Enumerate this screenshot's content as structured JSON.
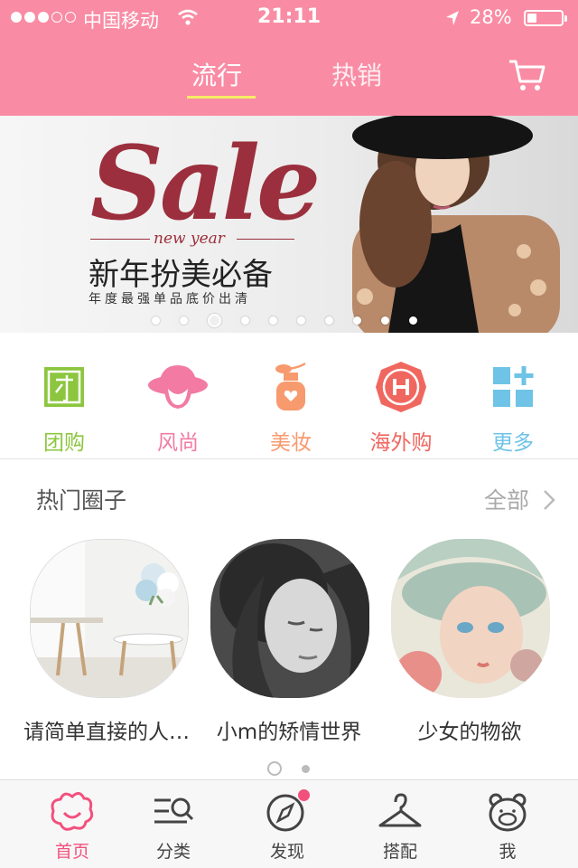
{
  "status_bar": {
    "carrier": "中国移动",
    "time": "21:11",
    "battery_percent": "28%",
    "battery_level": 0.28,
    "signal_strength": 3,
    "signal_max": 5
  },
  "header": {
    "tabs": [
      {
        "label": "流行",
        "active": true
      },
      {
        "label": "热销",
        "active": false
      }
    ],
    "cart_icon": "cart-icon",
    "bg_color": "#f98ca4",
    "underline_color": "#f6ec65"
  },
  "banner": {
    "headline": "Sale",
    "subscript": "new year",
    "slogan": "新年扮美必备",
    "slogan_sub": "年度最强单品底价出清",
    "pages": 10,
    "active_page": 3
  },
  "categories": [
    {
      "label": "团购",
      "icon": "group-buy-icon",
      "color": "#8cc63f"
    },
    {
      "label": "风尚",
      "icon": "fashion-hat-icon",
      "color": "#f27aa3"
    },
    {
      "label": "美妆",
      "icon": "perfume-icon",
      "color": "#f79a6e"
    },
    {
      "label": "海外购",
      "icon": "overseas-h-icon",
      "color": "#f0675f"
    },
    {
      "label": "更多",
      "icon": "more-grid-icon",
      "color": "#6ec3e6"
    }
  ],
  "circles_section": {
    "title": "热门圈子",
    "more_label": "全部",
    "items": [
      {
        "name": "请简单直接的人…"
      },
      {
        "name": "小m的矫情世界"
      },
      {
        "name": "少女的物欲"
      }
    ],
    "pages": 2,
    "active_page": 1
  },
  "tabbar": {
    "items": [
      {
        "label": "首页",
        "icon": "home-flower-icon",
        "active": true
      },
      {
        "label": "分类",
        "icon": "category-search-icon",
        "active": false
      },
      {
        "label": "发现",
        "icon": "discover-compass-icon",
        "active": false,
        "badge": true
      },
      {
        "label": "搭配",
        "icon": "hanger-icon",
        "active": false
      },
      {
        "label": "我",
        "icon": "profile-bear-icon",
        "active": false
      }
    ],
    "active_color": "#f2507d"
  }
}
